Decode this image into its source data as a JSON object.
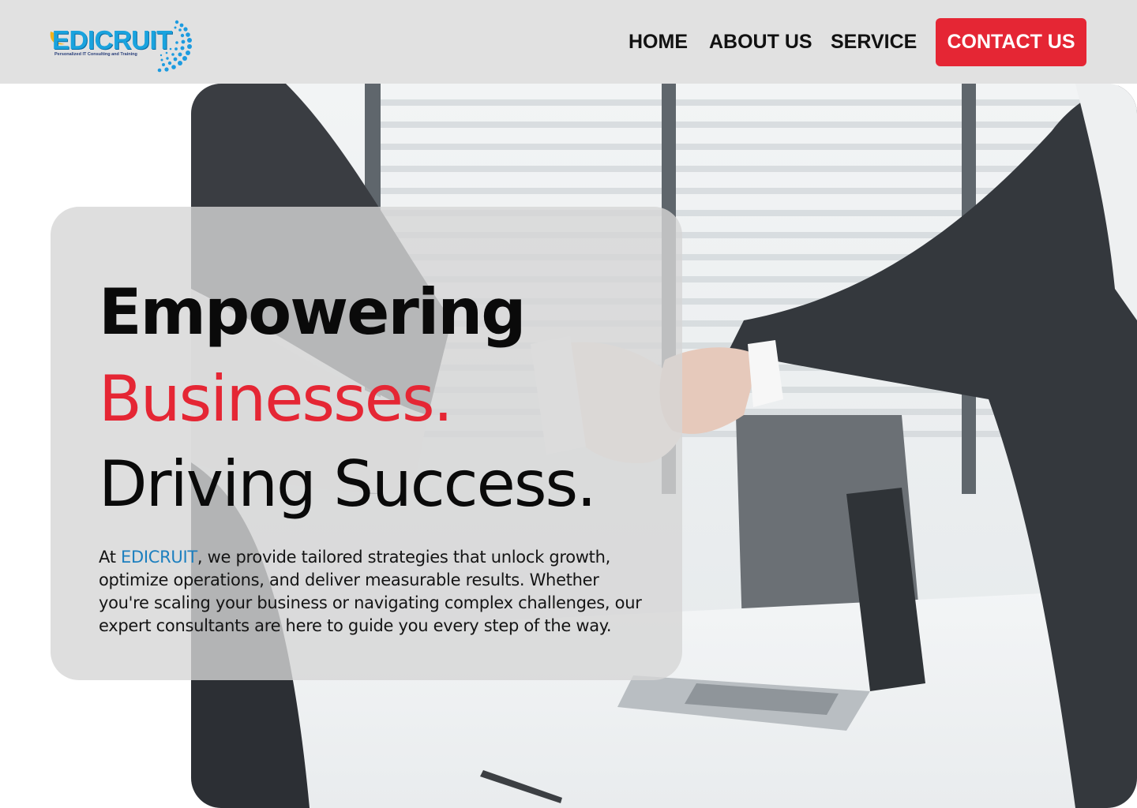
{
  "header": {
    "logo": {
      "wordmark": "EDICRUIT",
      "tagline": "Personalized IT Consulting and Training"
    },
    "nav": [
      {
        "label": "HOME"
      },
      {
        "label": "ABOUT US"
      },
      {
        "label": "SERVICE"
      }
    ],
    "cta_label": "CONTACT US"
  },
  "hero": {
    "headline_line1": "Empowering",
    "headline_line2": "Businesses.",
    "headline_line3": "Driving Success.",
    "intro_prefix": "At ",
    "intro_brand": "EDICRUIT",
    "intro_body": ", we provide tailored strategies that unlock growth, optimize operations, and deliver measurable results. Whether you're scaling your business or navigating complex challenges, our expert consultants are here to guide you every step of the way.",
    "image_icon": "handshake-photo"
  },
  "colors": {
    "accent_red": "#e52634",
    "brand_blue": "#1c7fbf",
    "header_bg": "#e1e1e1"
  }
}
